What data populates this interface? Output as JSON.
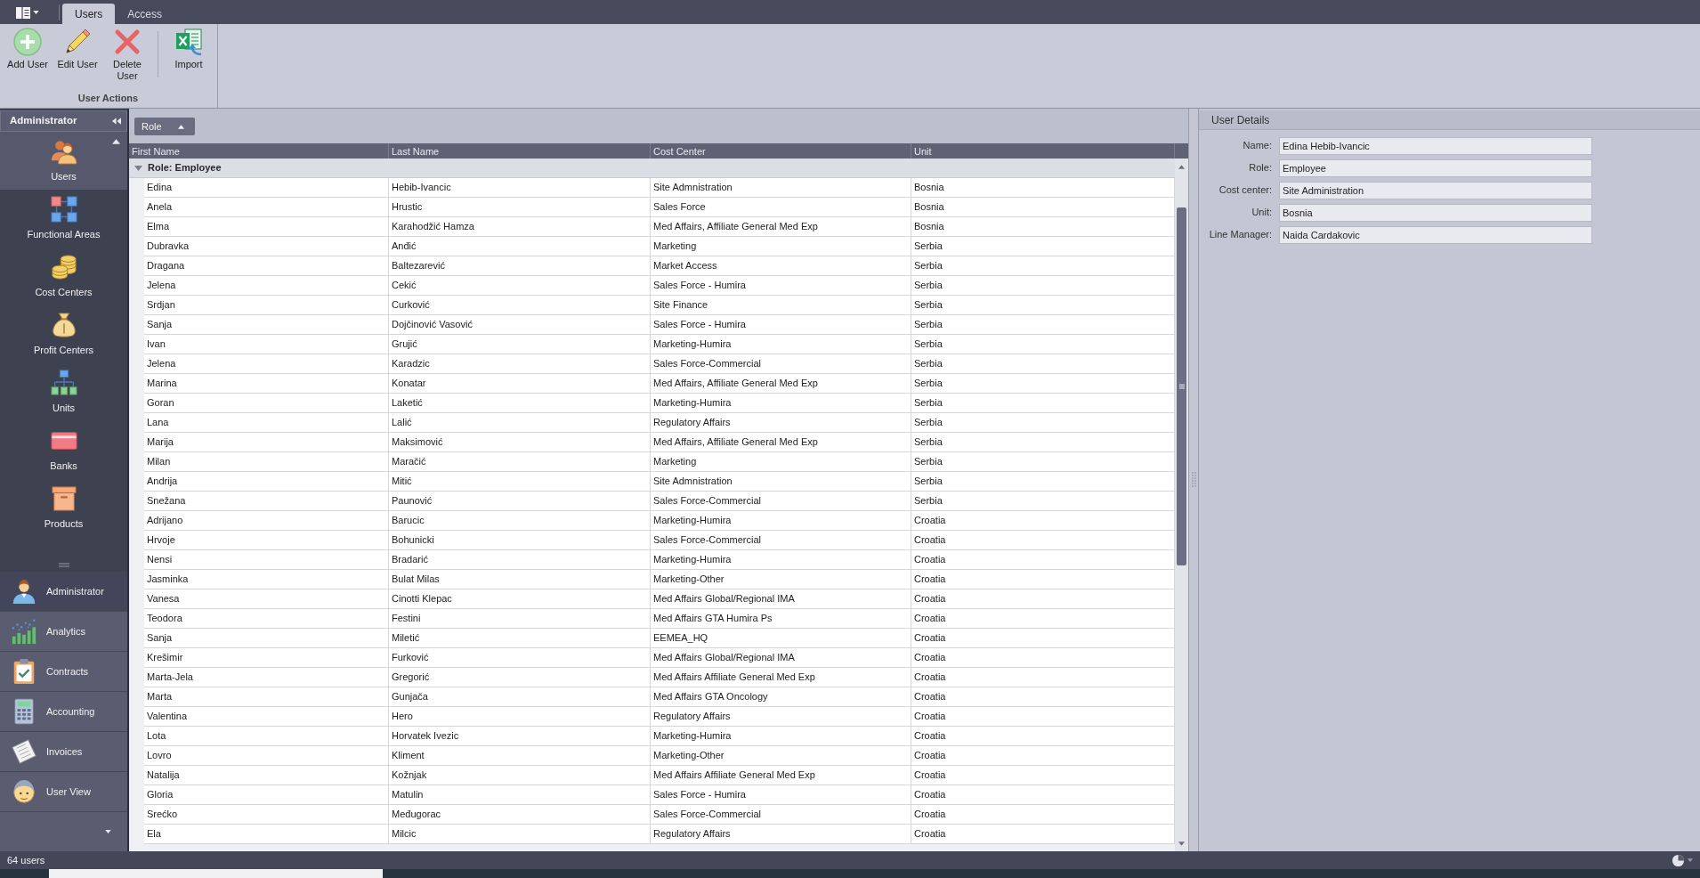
{
  "ribbon_tabs": [
    {
      "label": "Users",
      "selected": true
    },
    {
      "label": "Access",
      "selected": false
    }
  ],
  "ribbon_groups": [
    {
      "label": "User Actions",
      "button_sets": [
        [
          {
            "label": "Add User",
            "kind": "add"
          },
          {
            "label": "Edit User",
            "kind": "edit"
          },
          {
            "label": "Delete User",
            "kind": "delete"
          }
        ],
        [
          {
            "label": "Import",
            "kind": "import"
          }
        ]
      ]
    }
  ],
  "sidebar": {
    "title": "Administrator",
    "items": [
      {
        "label": "Users",
        "kind": "users",
        "selected": true
      },
      {
        "label": "Functional Areas",
        "kind": "areas",
        "selected": false
      },
      {
        "label": "Cost Centers",
        "kind": "coins",
        "selected": false
      },
      {
        "label": "Profit Centers",
        "kind": "bag",
        "selected": false
      },
      {
        "label": "Units",
        "kind": "orgchart",
        "selected": false
      },
      {
        "label": "Banks",
        "kind": "card",
        "selected": false
      },
      {
        "label": "Products",
        "kind": "box",
        "selected": false
      }
    ],
    "nav": [
      {
        "label": "Administrator",
        "kind": "admin",
        "selected": true
      },
      {
        "label": "Analytics",
        "kind": "chart",
        "selected": false
      },
      {
        "label": "Contracts",
        "kind": "clipboard",
        "selected": false
      },
      {
        "label": "Accounting",
        "kind": "calculator",
        "selected": false
      },
      {
        "label": "Invoices",
        "kind": "paper",
        "selected": false
      },
      {
        "label": "User View",
        "kind": "face",
        "selected": false
      }
    ]
  },
  "grid": {
    "group_by": "Role",
    "columns": [
      "First Name",
      "Last Name",
      "Cost Center",
      "Unit"
    ],
    "group": {
      "label": "Role: Employee",
      "expanded": true
    },
    "rows": [
      [
        "Edina",
        "Hebib-Ivancic",
        "Site Admnistration",
        "Bosnia"
      ],
      [
        "Anela",
        "Hrustic",
        "Sales Force",
        "Bosnia"
      ],
      [
        "Elma",
        "Karahodžić Hamza",
        "Med Affairs, Affiliate General Med Exp",
        "Bosnia"
      ],
      [
        "Dubravka",
        "Anđić",
        "Marketing",
        "Serbia"
      ],
      [
        "Dragana",
        "Baltezarević",
        "Market Access",
        "Serbia"
      ],
      [
        "Jelena",
        "Cekić",
        "Sales Force - Humira",
        "Serbia"
      ],
      [
        "Srdjan",
        "Curković",
        "Site Finance",
        "Serbia"
      ],
      [
        "Sanja",
        "Dojčinović Vasović",
        "Sales Force - Humira",
        "Serbia"
      ],
      [
        "Ivan",
        "Grujić",
        "Marketing-Humira",
        "Serbia"
      ],
      [
        "Jelena",
        "Karadzic",
        "Sales Force-Commercial",
        "Serbia"
      ],
      [
        "Marina",
        "Konatar",
        "Med Affairs, Affiliate General Med Exp",
        "Serbia"
      ],
      [
        "Goran",
        "Laketić",
        "Marketing-Humira",
        "Serbia"
      ],
      [
        "Lana",
        "Lalić",
        "Regulatory Affairs",
        "Serbia"
      ],
      [
        "Marija",
        "Maksimović",
        "Med Affairs, Affiliate General Med Exp",
        "Serbia"
      ],
      [
        "Milan",
        "Maračić",
        "Marketing",
        "Serbia"
      ],
      [
        "Andrija",
        "Mitić",
        "Site Admnistration",
        "Serbia"
      ],
      [
        "Snežana",
        "Paunović",
        "Sales Force-Commercial",
        "Serbia"
      ],
      [
        "Adrijano",
        "Barucic",
        "Marketing-Humira",
        "Croatia"
      ],
      [
        "Hrvoje",
        "Bohunicki",
        "Sales Force-Commercial",
        "Croatia"
      ],
      [
        "Nensi",
        "Bradarić",
        "Marketing-Humira",
        "Croatia"
      ],
      [
        "Jasminka",
        "Bulat Milas",
        "Marketing-Other",
        "Croatia"
      ],
      [
        "Vanesa",
        "Cinotti Klepac",
        "Med Affairs Global/Regional IMA",
        "Croatia"
      ],
      [
        "Teodora",
        "Festini",
        "Med Affairs GTA Humira Ps",
        "Croatia"
      ],
      [
        "Sanja",
        "Miletić",
        "EEMEA_HQ",
        "Croatia"
      ],
      [
        "Krešimir",
        "Furković",
        "Med Affairs Global/Regional IMA",
        "Croatia"
      ],
      [
        "Marta-Jela",
        "Gregorić",
        "Med Affairs Affiliate General Med Exp",
        "Croatia"
      ],
      [
        "Marta",
        "Gunjača",
        "Med Affairs GTA Oncology",
        "Croatia"
      ],
      [
        "Valentina",
        "Hero",
        "Regulatory Affairs",
        "Croatia"
      ],
      [
        "Lota",
        "Horvatek Ivezic",
        "Marketing-Humira",
        "Croatia"
      ],
      [
        "Lovro",
        "Kliment",
        "Marketing-Other",
        "Croatia"
      ],
      [
        "Natalija",
        "Kožnjak",
        "Med Affairs Affiliate General Med Exp",
        "Croatia"
      ],
      [
        "Gloria",
        "Matulin",
        "Sales Force - Humira",
        "Croatia"
      ],
      [
        "Srećko",
        "Međugorac",
        "Sales Force-Commercial",
        "Croatia"
      ],
      [
        "Ela",
        "Milcic",
        "Regulatory Affairs",
        "Croatia"
      ]
    ]
  },
  "details": {
    "title": "User Details",
    "fields": [
      {
        "label": "Name:",
        "value": "Edina Hebib-Ivancic"
      },
      {
        "label": "Role:",
        "value": "Employee"
      },
      {
        "label": "Cost center:",
        "value": "Site Administration"
      },
      {
        "label": "Unit:",
        "value": "Bosnia"
      },
      {
        "label": "Line Manager:",
        "value": "Naida Cardakovic"
      }
    ]
  },
  "status_bar": {
    "text": "64 users"
  }
}
